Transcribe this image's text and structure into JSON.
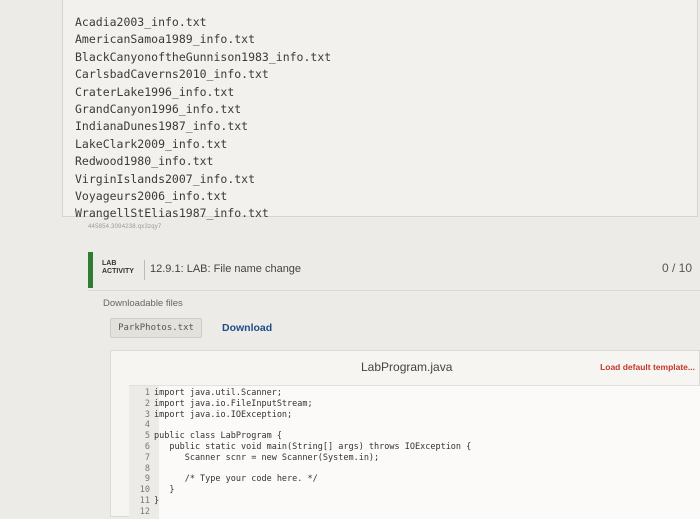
{
  "files": [
    "Acadia2003_info.txt",
    "AmericanSamoa1989_info.txt",
    "BlackCanyonoftheGunnison1983_info.txt",
    "CarlsbadCaverns2010_info.txt",
    "CraterLake1996_info.txt",
    "GrandCanyon1996_info.txt",
    "IndianaDunes1987_info.txt",
    "LakeClark2009_info.txt",
    "Redwood1980_info.txt",
    "VirginIslands2007_info.txt",
    "Voyageurs2006_info.txt",
    "WrangellStElias1987_info.txt"
  ],
  "activity_id": "445854.3094238.qx3zqy7",
  "lab": {
    "tag_line1": "LAB",
    "tag_line2": "ACTIVITY",
    "title": "12.9.1: LAB: File name change",
    "score": "0 / 10"
  },
  "downloads": {
    "label": "Downloadable files",
    "file": "ParkPhotos.txt",
    "link": "Download"
  },
  "editor": {
    "filename": "LabProgram.java",
    "load_template": "Load default template...",
    "lines": [
      {
        "n": "1",
        "text": "import java.util.Scanner;"
      },
      {
        "n": "2",
        "text": "import java.io.FileInputStream;"
      },
      {
        "n": "3",
        "text": "import java.io.IOException;"
      },
      {
        "n": "4",
        "text": ""
      },
      {
        "n": "5",
        "text": "public class LabProgram {"
      },
      {
        "n": "6",
        "text": "   public static void main(String[] args) throws IOException {"
      },
      {
        "n": "7",
        "text": "      Scanner scnr = new Scanner(System.in);"
      },
      {
        "n": "8",
        "text": ""
      },
      {
        "n": "9",
        "text": "      /* Type your code here. */"
      },
      {
        "n": "10",
        "text": "   }"
      },
      {
        "n": "11",
        "text": "}"
      },
      {
        "n": "12",
        "text": ""
      }
    ]
  }
}
